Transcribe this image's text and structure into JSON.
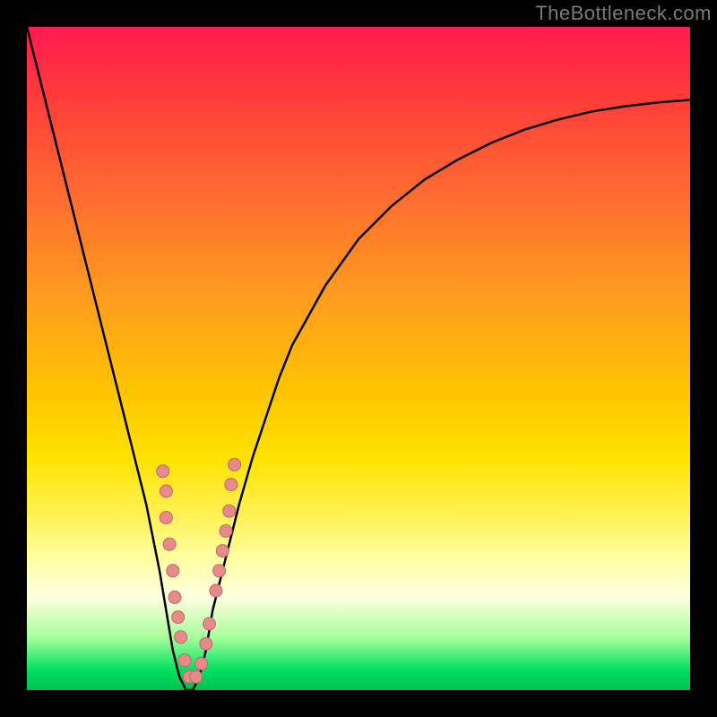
{
  "watermark": "TheBottleneck.com",
  "colors": {
    "frame": "#000000",
    "curve": "#000000",
    "marker_fill": "#e88a8a",
    "marker_stroke": "#c06868"
  },
  "chart_data": {
    "type": "line",
    "title": "",
    "xlabel": "",
    "ylabel": "",
    "xlim": [
      0,
      100
    ],
    "ylim": [
      0,
      100
    ],
    "series": [
      {
        "name": "bottleneck-curve",
        "x": [
          0,
          2,
          4,
          6,
          8,
          10,
          12,
          14,
          16,
          18,
          20,
          21,
          22,
          23,
          24,
          25,
          26,
          27,
          28,
          30,
          32,
          34,
          36,
          38,
          40,
          45,
          50,
          55,
          60,
          65,
          70,
          75,
          80,
          85,
          90,
          95,
          100
        ],
        "y": [
          100,
          92,
          84,
          76,
          68,
          60,
          52,
          44,
          36,
          28,
          18,
          12,
          6,
          2,
          0,
          0,
          2,
          6,
          12,
          20,
          28,
          35,
          41,
          47,
          52,
          61,
          68,
          73,
          77,
          80,
          82.5,
          84.5,
          86,
          87.2,
          88,
          88.6,
          89
        ]
      }
    ],
    "markers": [
      {
        "x": 20.5,
        "y": 33
      },
      {
        "x": 21.0,
        "y": 30
      },
      {
        "x": 21.0,
        "y": 26
      },
      {
        "x": 21.5,
        "y": 22
      },
      {
        "x": 22.0,
        "y": 18
      },
      {
        "x": 22.3,
        "y": 14
      },
      {
        "x": 22.8,
        "y": 11
      },
      {
        "x": 23.2,
        "y": 8
      },
      {
        "x": 23.8,
        "y": 4.5
      },
      {
        "x": 24.5,
        "y": 2
      },
      {
        "x": 25.5,
        "y": 2
      },
      {
        "x": 26.3,
        "y": 4
      },
      {
        "x": 27.0,
        "y": 7
      },
      {
        "x": 27.5,
        "y": 10
      },
      {
        "x": 28.5,
        "y": 15
      },
      {
        "x": 29.0,
        "y": 18
      },
      {
        "x": 29.5,
        "y": 21
      },
      {
        "x": 30.0,
        "y": 24
      },
      {
        "x": 30.5,
        "y": 27
      },
      {
        "x": 30.8,
        "y": 31
      },
      {
        "x": 31.3,
        "y": 34
      }
    ]
  }
}
